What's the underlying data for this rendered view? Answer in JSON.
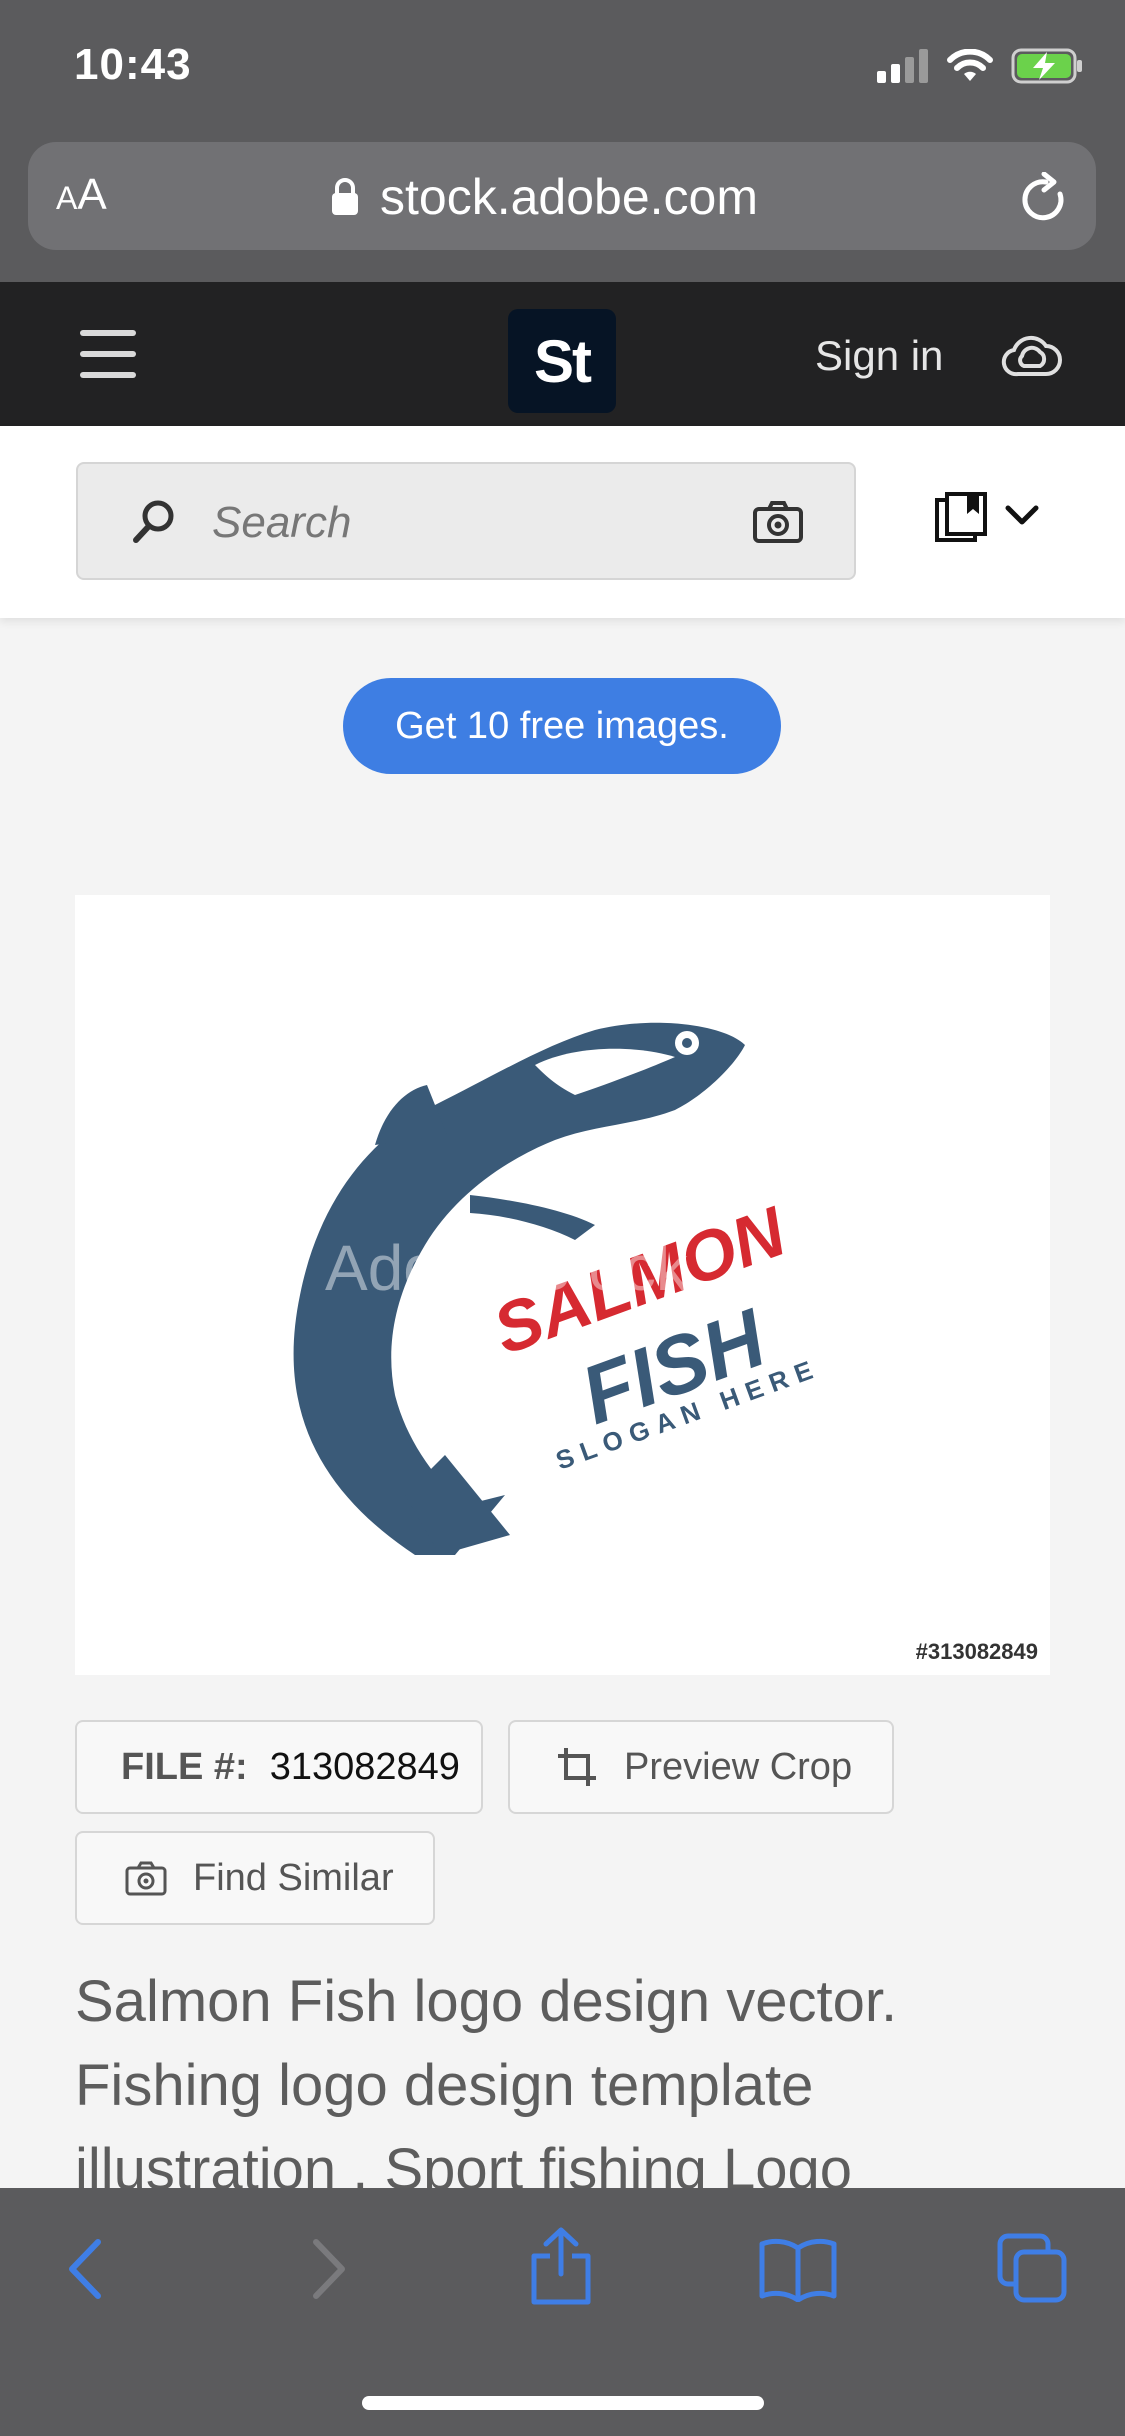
{
  "status_bar": {
    "time": "10:43"
  },
  "browser": {
    "aa_small": "A",
    "aa_large": "A",
    "url": "stock.adobe.com"
  },
  "header": {
    "logo_text": "St",
    "sign_in": "Sign in"
  },
  "search": {
    "placeholder": "Search"
  },
  "promo": {
    "label": "Get 10 free images."
  },
  "image": {
    "file_tag": "#313082849",
    "logo_line1": "SALMON",
    "logo_line2": "FISH",
    "logo_line3": "SLOGAN HERE",
    "watermark": "Adobe Stock"
  },
  "actions": {
    "file_label": "FILE #:",
    "file_number": "313082849",
    "preview_crop": "Preview Crop",
    "find_similar": "Find Similar"
  },
  "description": "Salmon Fish logo design vector. Fishing logo design template illustration . Sport fishing Logo",
  "colors": {
    "browser_chrome": "#5b5b5d",
    "header": "#222223",
    "accent_blue": "#3e7ee3",
    "toolbar_icon_blue": "#3f7ee6",
    "fish_blue": "#3a5a78",
    "logo_red": "#d62a31"
  }
}
